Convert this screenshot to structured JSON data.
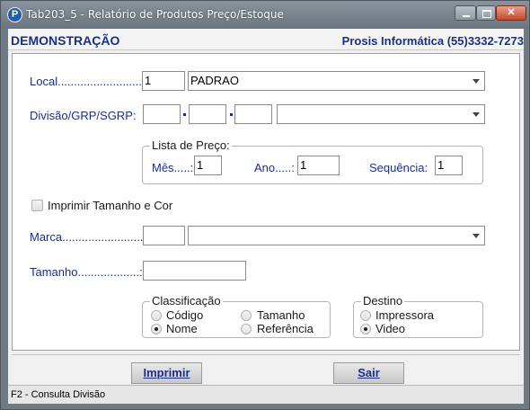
{
  "window": {
    "app_icon": "P",
    "title": "Tab203_5 -  Relatório de Produtos Preço/Estoque"
  },
  "banner": {
    "left": "DEMONSTRAÇÃO",
    "right": "Prosis Informática (55)3332-7273"
  },
  "form": {
    "local": {
      "label": "Local.............................:",
      "code": "1",
      "name": "PADRAO"
    },
    "divisao": {
      "label": "Divisão/GRP/SGRP:",
      "div": "",
      "grp": "",
      "sgrp": "",
      "desc": ""
    },
    "lista_preco": {
      "title": "Lista de Preço:",
      "mes_label": "Mês.....:",
      "mes": "1",
      "ano_label": "Ano.....:",
      "ano": "1",
      "seq_label": "Sequência:",
      "seq": "1"
    },
    "imprimir_tamanho_cor": {
      "label": "Imprimir Tamanho e Cor",
      "checked": false
    },
    "marca": {
      "label": "Marca...........................:",
      "code": "",
      "name": ""
    },
    "tamanho": {
      "label": "Tamanho...................:",
      "value": ""
    },
    "classificacao": {
      "title": "Classificação",
      "options": [
        "Código",
        "Tamanho",
        "Nome",
        "Referência"
      ],
      "selected": "Nome"
    },
    "destino": {
      "title": "Destino",
      "options": [
        "Impressora",
        "Video"
      ],
      "selected": "Video"
    }
  },
  "buttons": {
    "imprimir": "Imprimir",
    "sair": "Sair"
  },
  "status": "F2 - Consulta Divisão",
  "colors": {
    "label_blue": "#1c2f86",
    "frame": "#6f7a85",
    "close_red": "#c4472a"
  }
}
